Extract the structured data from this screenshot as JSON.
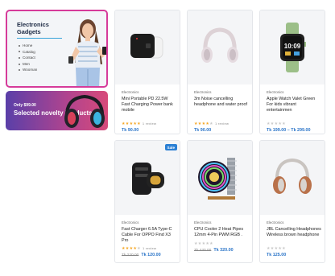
{
  "sidebar": {
    "title_line1": "Electronics",
    "title_line2": "Gadgets",
    "links": [
      "Home",
      "Catalog",
      "Contact",
      "Men",
      "Wooman"
    ]
  },
  "banner": {
    "small_text": "Only $99.00",
    "big_text": "Selected novelty Products"
  },
  "products": [
    {
      "category": "Electronics",
      "name": "Mini Portable PD 22.5W Fast Charging Power bank mobile",
      "stars": "★★★★★",
      "empty_stars": "",
      "reviews": "1 review",
      "old_price": "",
      "price": "Tk 90.00",
      "badge": "",
      "icon": "power-bank-icon"
    },
    {
      "category": "Electronics",
      "name": "3m Noise cancelling headphone and water proof",
      "stars": "★★★★",
      "empty_stars": "★",
      "reviews": "1 review",
      "old_price": "",
      "price": "Tk 90.00",
      "badge": "",
      "icon": "headphone-icon"
    },
    {
      "category": "Electronics",
      "name": "Apple Watch Valet Green For kids vibrant entertainmen",
      "stars": "",
      "empty_stars": "★★★★★",
      "reviews": "",
      "old_price": "",
      "price": "Tk 199.00 – Tk 299.00",
      "badge": "",
      "icon": "smartwatch-icon"
    },
    {
      "category": "Electronics",
      "name": "Fast Charger 6.5A Type-C Cable For OPPO Find X3 Pro",
      "stars": "★★★★",
      "empty_stars": "★",
      "reviews": "1 review",
      "old_price": "Tk 220.00",
      "price": "Tk 120.00",
      "badge": "Sale",
      "icon": "car-charger-icon"
    },
    {
      "category": "Electronics",
      "name": "CPU Cooler 2 Heat Pipes 12mm 4-Pin PWM RGB .",
      "stars": "",
      "empty_stars": "★★★★★",
      "reviews": "",
      "old_price": "Tk 440.00",
      "price": "Tk 320.00",
      "badge": "",
      "icon": "cpu-cooler-icon"
    },
    {
      "category": "Electronics",
      "name": "JBL Cancelling Headphones Wireless brown headphone",
      "stars": "",
      "empty_stars": "★★★★★",
      "reviews": "",
      "old_price": "",
      "price": "Tk 125.00",
      "badge": "",
      "icon": "brown-headphone-icon"
    }
  ],
  "colors": {
    "accent": "#d63b9a",
    "price": "#2a74c8",
    "star": "#f5a623",
    "badge": "#2a7fd4"
  }
}
